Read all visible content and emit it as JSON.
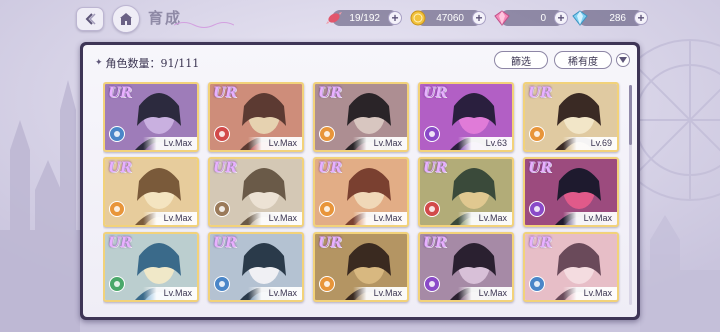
{
  "header": {
    "title": "育成"
  },
  "resources": {
    "candy": {
      "value": "19/192",
      "icon": "candy-icon",
      "color": "#e2566c"
    },
    "coin": {
      "value": "47060",
      "icon": "coin-icon",
      "color": "#f2c23c"
    },
    "gem_pink": {
      "value": "0",
      "icon": "pink-diamond-icon",
      "color": "#f58ab8"
    },
    "gem_blue": {
      "value": "286",
      "icon": "blue-diamond-icon",
      "color": "#7fd0f2"
    }
  },
  "panel": {
    "count_label": "角色数量：91/111",
    "filter_label": "篩选",
    "rarity_label": "稀有度"
  },
  "cards": [
    {
      "rarity": "UR",
      "level": "Lv.Max",
      "attr": "blue",
      "palette": [
        "#2c2a3e",
        "#6b3f8a",
        "#c9b0e0"
      ]
    },
    {
      "rarity": "UR",
      "level": "Lv.Max",
      "attr": "red",
      "palette": [
        "#5c3a32",
        "#b23a3a",
        "#e6d2b0"
      ]
    },
    {
      "rarity": "UR",
      "level": "Lv.Max",
      "attr": "orange",
      "palette": [
        "#2a2428",
        "#7a4a5a",
        "#d8c6c0"
      ]
    },
    {
      "rarity": "UR",
      "level": "Lv.63",
      "attr": "purple",
      "palette": [
        "#2a1f3e",
        "#7b3fb0",
        "#e07bd8"
      ]
    },
    {
      "rarity": "UR",
      "level": "Lv.69",
      "attr": "orange",
      "palette": [
        "#3a2a24",
        "#c9a870",
        "#f2e6c8"
      ]
    },
    {
      "rarity": "UR",
      "level": "Lv.Max",
      "attr": "orange",
      "palette": [
        "#7a5a3a",
        "#d8b070",
        "#f4e4c0"
      ]
    },
    {
      "rarity": "UR",
      "level": "Lv.Max",
      "attr": "brown",
      "palette": [
        "#6a5a48",
        "#b8a890",
        "#ece2d4"
      ]
    },
    {
      "rarity": "UR",
      "level": "Lv.Max",
      "attr": "orange",
      "palette": [
        "#7a4030",
        "#d07a4a",
        "#f0d8b8"
      ]
    },
    {
      "rarity": "UR",
      "level": "Lv.Max",
      "attr": "red",
      "palette": [
        "#3a4a3a",
        "#7a8a5a",
        "#e0c890"
      ]
    },
    {
      "rarity": "UR",
      "level": "Lv.Max",
      "attr": "purple",
      "palette": [
        "#1e1a2e",
        "#4a3a6e",
        "#e05a8a"
      ]
    },
    {
      "rarity": "UR",
      "level": "Lv.Max",
      "attr": "green",
      "palette": [
        "#3a6a8a",
        "#7ab0d8",
        "#f0e8c8"
      ]
    },
    {
      "rarity": "UR",
      "level": "Lv.Max",
      "attr": "blue",
      "palette": [
        "#2a3a4a",
        "#6a8aa8",
        "#f0f0f4"
      ]
    },
    {
      "rarity": "UR",
      "level": "Lv.Max",
      "attr": "orange",
      "palette": [
        "#3a2a20",
        "#8a6a40",
        "#d8b880"
      ]
    },
    {
      "rarity": "UR",
      "level": "Lv.Max",
      "attr": "purple",
      "palette": [
        "#2a2030",
        "#6a4a6a",
        "#d8c0d8"
      ]
    },
    {
      "rarity": "UR",
      "level": "Lv.Max",
      "attr": "blue",
      "palette": [
        "#6a4a5a",
        "#d89aa8",
        "#f4dce0"
      ]
    }
  ]
}
